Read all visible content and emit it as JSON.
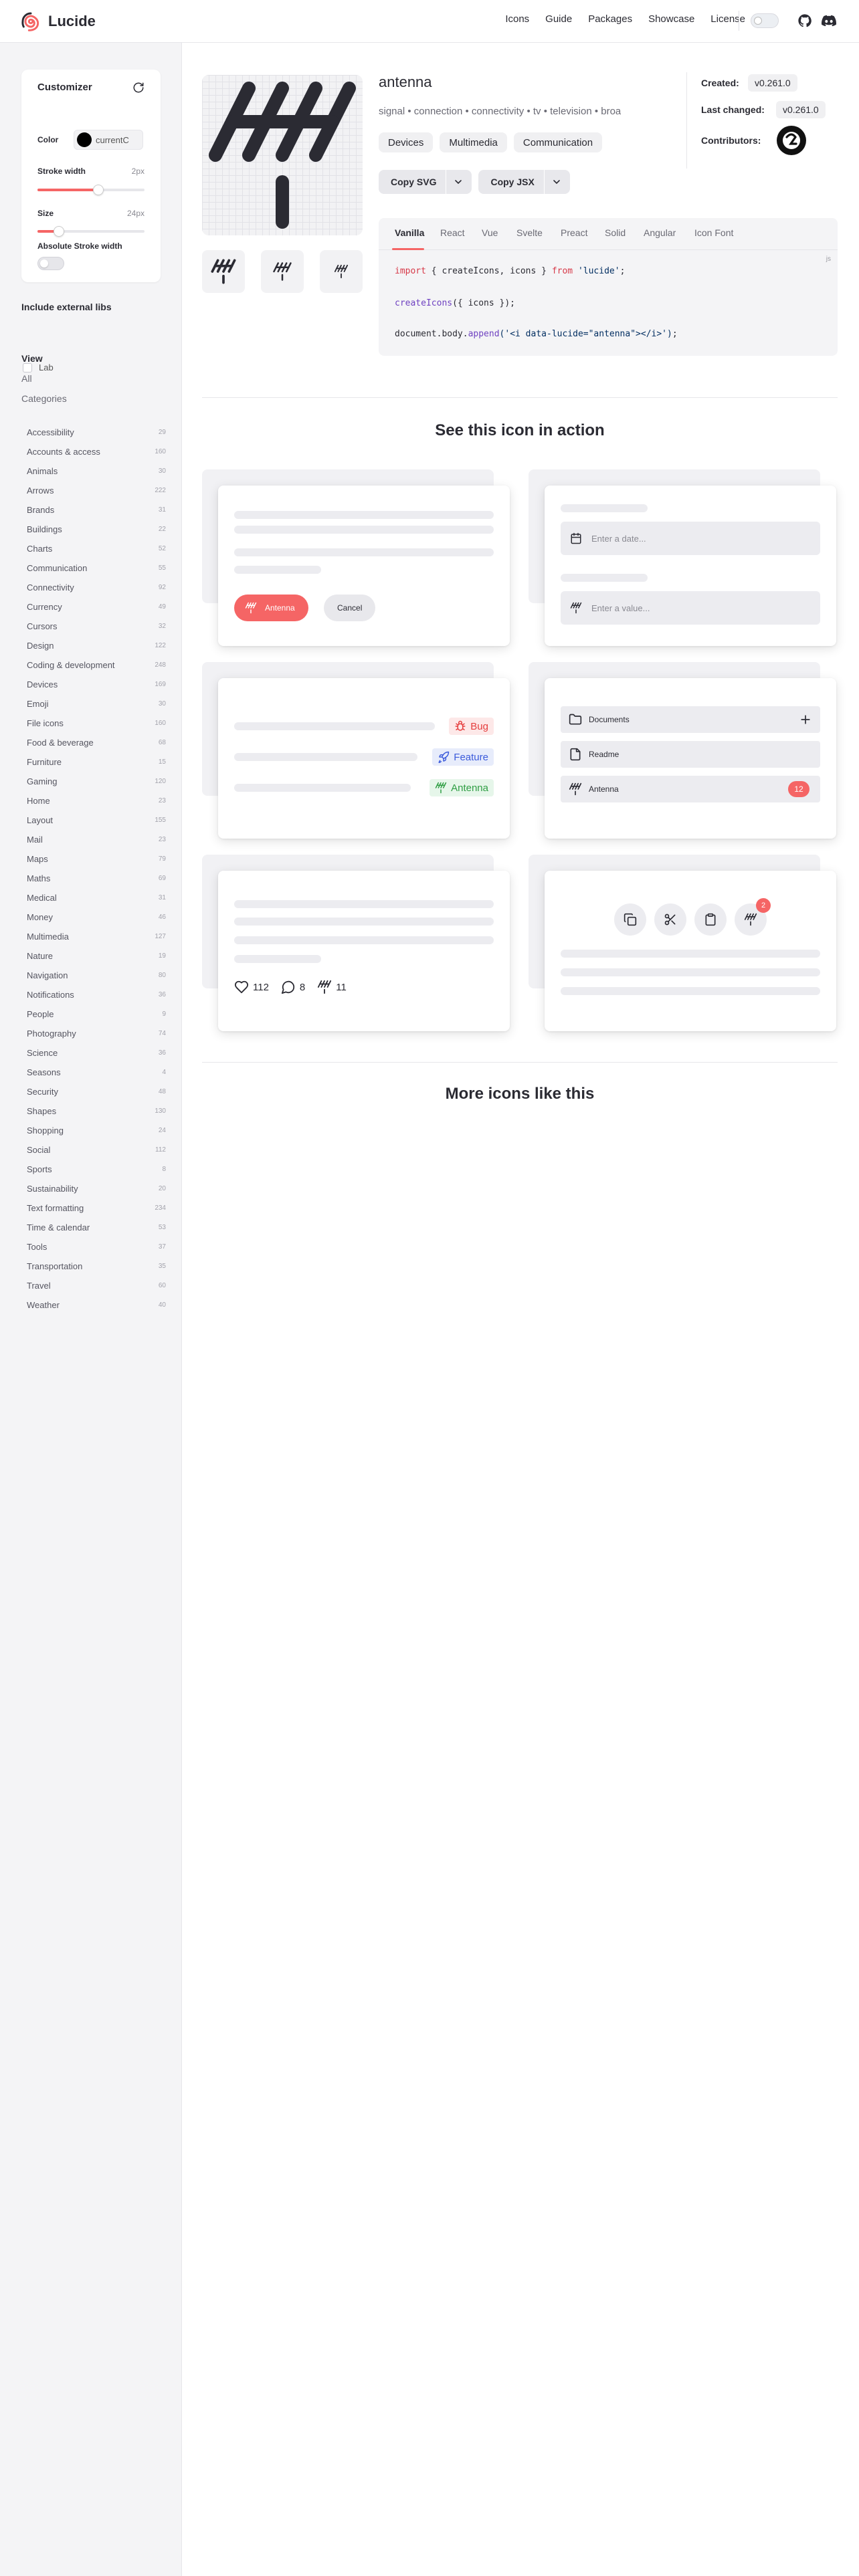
{
  "brand": {
    "name": "Lucide"
  },
  "nav": {
    "links": [
      "Icons",
      "Guide",
      "Packages",
      "Showcase",
      "License"
    ]
  },
  "customizer": {
    "title": "Customizer",
    "color_label": "Color",
    "color_value": "currentC",
    "stroke_label": "Stroke width",
    "stroke_value": "2px",
    "stroke_fraction": 0.57,
    "size_label": "Size",
    "size_value": "24px",
    "size_fraction": 0.2,
    "abs_label": "Absolute Stroke width",
    "abs_on": false
  },
  "sidebar": {
    "external_heading": "Include external libs",
    "external_lib": "Lab",
    "view_heading": "View",
    "all_link": "All",
    "categories_link": "Categories",
    "categories": [
      {
        "name": "Accessibility",
        "count": "29"
      },
      {
        "name": "Accounts & access",
        "count": "160"
      },
      {
        "name": "Animals",
        "count": "30"
      },
      {
        "name": "Arrows",
        "count": "222"
      },
      {
        "name": "Brands",
        "count": "31"
      },
      {
        "name": "Buildings",
        "count": "22"
      },
      {
        "name": "Charts",
        "count": "52"
      },
      {
        "name": "Communication",
        "count": "55"
      },
      {
        "name": "Connectivity",
        "count": "92"
      },
      {
        "name": "Currency",
        "count": "49"
      },
      {
        "name": "Cursors",
        "count": "32"
      },
      {
        "name": "Design",
        "count": "122"
      },
      {
        "name": "Coding & development",
        "count": "248"
      },
      {
        "name": "Devices",
        "count": "169"
      },
      {
        "name": "Emoji",
        "count": "30"
      },
      {
        "name": "File icons",
        "count": "160"
      },
      {
        "name": "Food & beverage",
        "count": "68"
      },
      {
        "name": "Furniture",
        "count": "15"
      },
      {
        "name": "Gaming",
        "count": "120"
      },
      {
        "name": "Home",
        "count": "23"
      },
      {
        "name": "Layout",
        "count": "155"
      },
      {
        "name": "Mail",
        "count": "23"
      },
      {
        "name": "Maps",
        "count": "79"
      },
      {
        "name": "Maths",
        "count": "69"
      },
      {
        "name": "Medical",
        "count": "31"
      },
      {
        "name": "Money",
        "count": "46"
      },
      {
        "name": "Multimedia",
        "count": "127"
      },
      {
        "name": "Nature",
        "count": "19"
      },
      {
        "name": "Navigation",
        "count": "80"
      },
      {
        "name": "Notifications",
        "count": "36"
      },
      {
        "name": "People",
        "count": "9"
      },
      {
        "name": "Photography",
        "count": "74"
      },
      {
        "name": "Science",
        "count": "36"
      },
      {
        "name": "Seasons",
        "count": "4"
      },
      {
        "name": "Security",
        "count": "48"
      },
      {
        "name": "Shapes",
        "count": "130"
      },
      {
        "name": "Shopping",
        "count": "24"
      },
      {
        "name": "Social",
        "count": "112"
      },
      {
        "name": "Sports",
        "count": "8"
      },
      {
        "name": "Sustainability",
        "count": "20"
      },
      {
        "name": "Text formatting",
        "count": "234"
      },
      {
        "name": "Time & calendar",
        "count": "53"
      },
      {
        "name": "Tools",
        "count": "37"
      },
      {
        "name": "Transportation",
        "count": "35"
      },
      {
        "name": "Travel",
        "count": "60"
      },
      {
        "name": "Weather",
        "count": "40"
      }
    ]
  },
  "icon": {
    "name": "antenna",
    "tags": "signal • connection • connectivity • tv • television • broadcast • live • frequency • tune • scan • channels • aerial • receiver • transmission • transducer • terrestrial • satellite • cable",
    "categories": [
      "Devices",
      "Multimedia",
      "Communication"
    ],
    "copy_svg": "Copy SVG",
    "copy_jsx": "Copy JSX",
    "created_label": "Created:",
    "created_value": "v0.261.0",
    "changed_label": "Last changed:",
    "changed_value": "v0.261.0",
    "contributors_label": "Contributors:"
  },
  "code": {
    "tabs": [
      "Vanilla",
      "React",
      "Vue",
      "Svelte",
      "Preact",
      "Solid",
      "Angular",
      "Icon Font"
    ],
    "lang": "js",
    "line1": {
      "kw1": "import",
      "mid": " { createIcons, icons } ",
      "kw2": "from",
      "str": " 'lucide'",
      "end": ";"
    },
    "line2": {
      "fn": "createIcons",
      "rest": "({ icons });"
    },
    "line3": {
      "pre": "document.body.",
      "fn": "append",
      "str": "('<i data-lucide=\"antenna\"></i>')",
      "end": ";"
    }
  },
  "in_action": {
    "title": "See this icon in action",
    "primary_button": "Antenna",
    "cancel_button": "Cancel",
    "date_placeholder": "Enter a date...",
    "value_placeholder": "Enter a value...",
    "tags": [
      {
        "label": "Bug",
        "color": "#e53e3e",
        "bg": "#fde8e8"
      },
      {
        "label": "Feature",
        "color": "#3b5bdb",
        "bg": "#e7ecfb"
      },
      {
        "label": "Antenna",
        "color": "#2f9e44",
        "bg": "#e6f6ea"
      }
    ],
    "files": {
      "documents": "Documents",
      "readme": "Readme",
      "antenna": "Antenna",
      "antenna_count": "12"
    },
    "stats": {
      "likes": "112",
      "comments": "8",
      "antenna": "11"
    },
    "notif_count": "2"
  },
  "more_icons": {
    "title": "More icons like this"
  },
  "colors": {
    "accent": "#f56565",
    "sidebar_bg": "#f4f4f6"
  }
}
